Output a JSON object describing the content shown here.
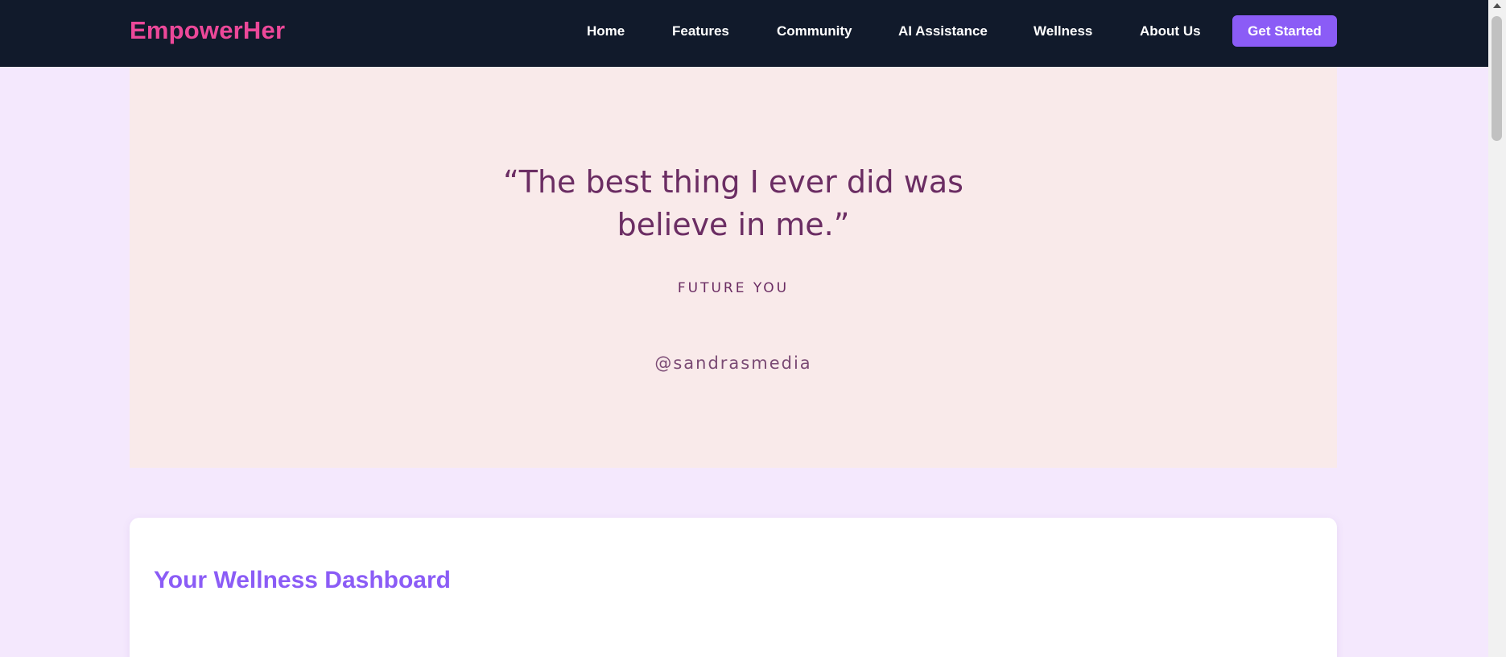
{
  "header": {
    "brand": "EmpowerHer",
    "nav": [
      {
        "label": "Home"
      },
      {
        "label": "Features"
      },
      {
        "label": "Community"
      },
      {
        "label": "AI Assistance"
      },
      {
        "label": "Wellness"
      },
      {
        "label": "About Us"
      }
    ],
    "cta_label": "Get Started"
  },
  "quote": {
    "line1": "“The best thing I ever did was",
    "line2": "believe in me.”",
    "author": "FUTURE YOU",
    "handle": "@sandrasmedia"
  },
  "dashboard": {
    "title": "Your Wellness Dashboard"
  },
  "colors": {
    "navbar_bg": "#111a2b",
    "brand": "#ec4899",
    "accent": "#8b5cf6",
    "page_bg": "#f4e8fd",
    "quote_bg": "#f9eaea",
    "quote_text": "#6b2d63"
  }
}
